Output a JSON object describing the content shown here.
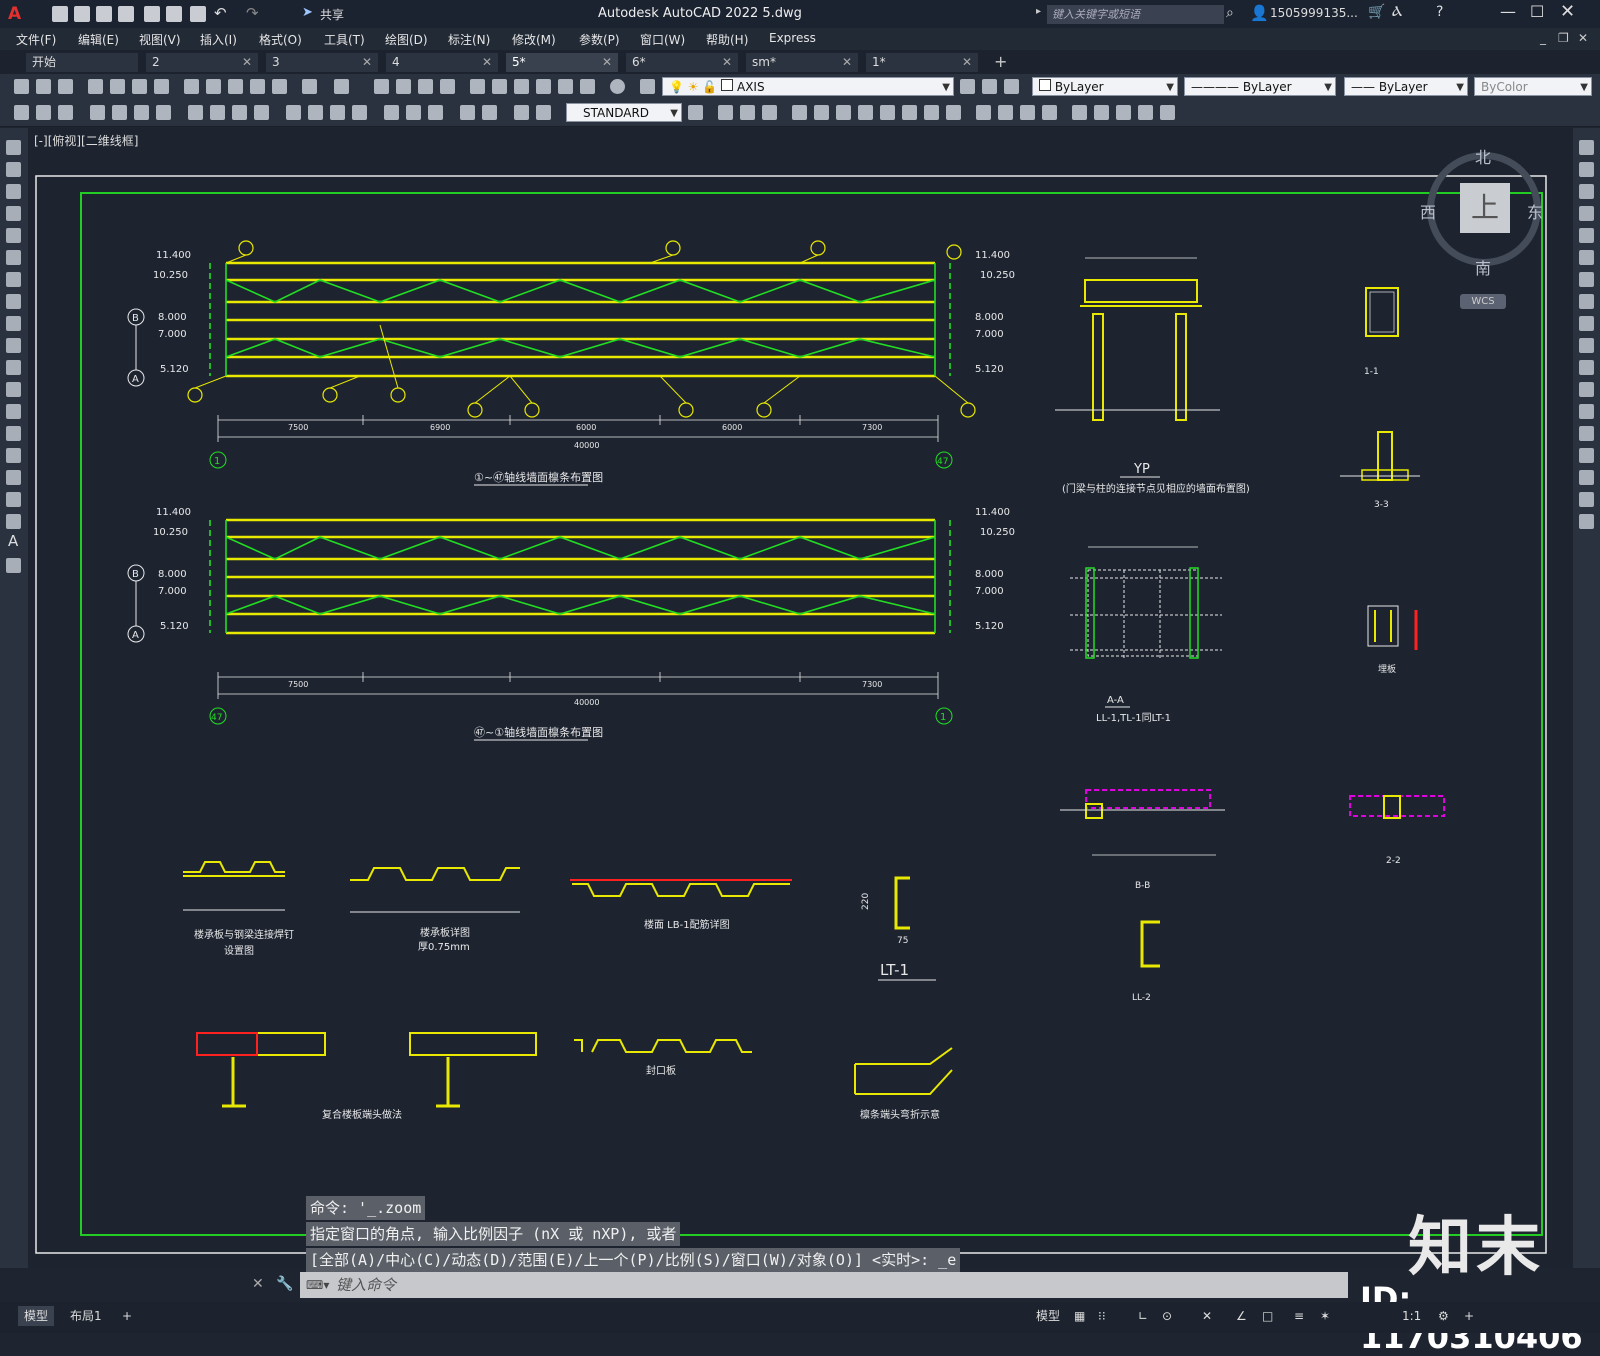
{
  "app": {
    "title": "Autodesk AutoCAD 2022    5.dwg",
    "search_placeholder": "键入关键字或短语",
    "user": "1505999135...",
    "share": "共享"
  },
  "menu": [
    "文件(F)",
    "编辑(E)",
    "视图(V)",
    "插入(I)",
    "格式(O)",
    "工具(T)",
    "绘图(D)",
    "标注(N)",
    "修改(M)",
    "参数(P)",
    "窗口(W)",
    "帮助(H)",
    "Express"
  ],
  "tabs": [
    {
      "label": "开始",
      "active": false
    },
    {
      "label": "2",
      "active": false
    },
    {
      "label": "3",
      "active": false
    },
    {
      "label": "4",
      "active": false
    },
    {
      "label": "5*",
      "active": true
    },
    {
      "label": "6*",
      "active": false
    },
    {
      "label": "sm*",
      "active": false
    },
    {
      "label": "1*",
      "active": false
    }
  ],
  "toolbar": {
    "layer": "AXIS",
    "color": "ByLayer",
    "linetype": "ByLayer",
    "lineweight": "ByLayer",
    "plotstyle": "ByColor",
    "textstyle": "STANDARD"
  },
  "viewport": {
    "label": "[-][俯视][二维线框]",
    "compass": {
      "north": "北",
      "south": "南",
      "east": "东",
      "west": "西",
      "center": "上",
      "wcs": "WCS"
    }
  },
  "drawing": {
    "plan1_title": "①~㊼轴线墙面檩条布置图",
    "plan2_title": "㊼~①轴线墙面檩条布置图",
    "elev_labels": [
      "11.400",
      "10.250",
      "8.000",
      "7.000",
      "5.120"
    ],
    "axis_b": "B",
    "axis_a": "A",
    "axis_1": "1",
    "axis_47": "47",
    "dims": [
      "7500",
      "6900",
      "6000",
      "6000",
      "7300"
    ],
    "total": "40000",
    "yp_title": "YP",
    "yp_sub": "(门梁与柱的连接节点见相应的墙面布置图)",
    "aa_title": "A-A",
    "aa_sub": "LL-1,TL-1同LT-1",
    "bb_title": "B-B",
    "s11": "1-1",
    "s33": "3-3",
    "s22": "2-2",
    "tieban": "埋板",
    "ll2": "LL-2",
    "lt1": "LT-1",
    "lt1_dims": [
      "220",
      "75"
    ],
    "d1": "楼承板与钢梁连接焊钉",
    "d1b": "设置图",
    "d2": "楼承板详图",
    "d2b": "厚0.75mm",
    "d3": "楼面 LB-1配筋详图",
    "d4": "复合楼板端头做法",
    "d5": "封口板",
    "d6": "檩条端头弯折示意"
  },
  "command": {
    "line1": "命令: '_.zoom",
    "line2": "指定窗口的角点, 输入比例因子 (nX 或 nXP), 或者",
    "line3": "[全部(A)/中心(C)/动态(D)/范围(E)/上一个(P)/比例(S)/窗口(W)/对象(O)] <实时>: _e",
    "placeholder": "键入命令"
  },
  "status": {
    "model_tab": "模型",
    "layout_tab": "布局1",
    "model": "模型",
    "scale": "1:1"
  },
  "watermark": {
    "logo": "知末",
    "id": "ID: 1170310406"
  },
  "colors": {
    "yellow": "#e8e800",
    "green": "#22dd22",
    "magenta": "#e000e0",
    "red": "#ff2020",
    "white": "#e8e8e8",
    "frame": "#22cc22"
  }
}
